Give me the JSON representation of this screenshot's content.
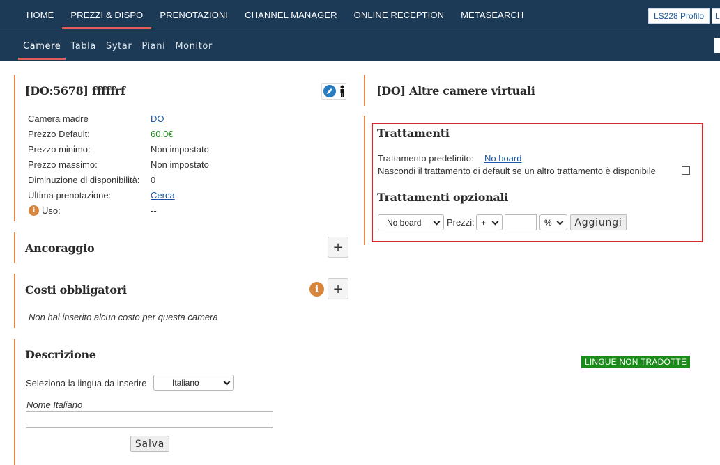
{
  "topnav": {
    "items": [
      "HOME",
      "PREZZI & DISPO",
      "PRENOTAZIONI",
      "CHANNEL MANAGER",
      "ONLINE RECEPTION",
      "METASEARCH"
    ],
    "active_index": 1,
    "profile_label": "LS228 Profilo",
    "profile_label2": "L"
  },
  "subnav": {
    "items": [
      "Camere",
      "Tabla",
      "Sytar",
      "Piani",
      "Monitor"
    ],
    "active_index": 0
  },
  "room": {
    "title": "[DO:5678] fffffrf",
    "rows": [
      {
        "label": "Camera madre",
        "value": "DO",
        "style": "link"
      },
      {
        "label": "Prezzo Default:",
        "value": "60.0€",
        "style": "green"
      },
      {
        "label": "Prezzo minimo:",
        "value": "Non impostato",
        "style": "plain"
      },
      {
        "label": "Prezzo massimo:",
        "value": "Non impostato",
        "style": "plain"
      },
      {
        "label": "Diminuzione di disponibilità:",
        "value": "0",
        "style": "plain"
      },
      {
        "label": "Ultima prenotazione:",
        "value": "Cerca",
        "style": "link"
      },
      {
        "label": "Uso:",
        "value": "--",
        "style": "plain"
      }
    ]
  },
  "ancoraggio": {
    "title": "Ancoraggio",
    "add_label": "+"
  },
  "costi": {
    "title": "Costi obbligatori",
    "add_label": "+",
    "empty_text": "Non hai inserito alcun costo per questa camera"
  },
  "descrizione": {
    "title": "Descrizione",
    "lang_label": "Seleziona la lingua da inserire",
    "lang_selected": "Italiano",
    "name_label": "Nome Italiano",
    "name_value": "",
    "save_label": "Salva",
    "untranslated_badge": "LINGUE NON TRADOTTE"
  },
  "virtual": {
    "title": "[DO] Altre camere virtuali"
  },
  "trattamenti": {
    "title": "Trattamenti",
    "default_label": "Trattamento predefinito:",
    "default_value": "No board",
    "hide_label": "Nascondi il trattamento di default se un altro trattamento è disponibile",
    "hide_checked": false,
    "optional_title": "Trattamenti opzionali",
    "board_selected": "No board",
    "prices_label": "Prezzi:",
    "sign_selected": "+",
    "amount_value": "",
    "unit_selected": "%",
    "add_label": "Aggiungi"
  },
  "colors": {
    "nav_bg": "#1c3a56",
    "accent": "#e35b5b",
    "section_border": "#e8874a",
    "highlight_box": "#d42a2a",
    "badge_bg": "#1a8a1a"
  }
}
